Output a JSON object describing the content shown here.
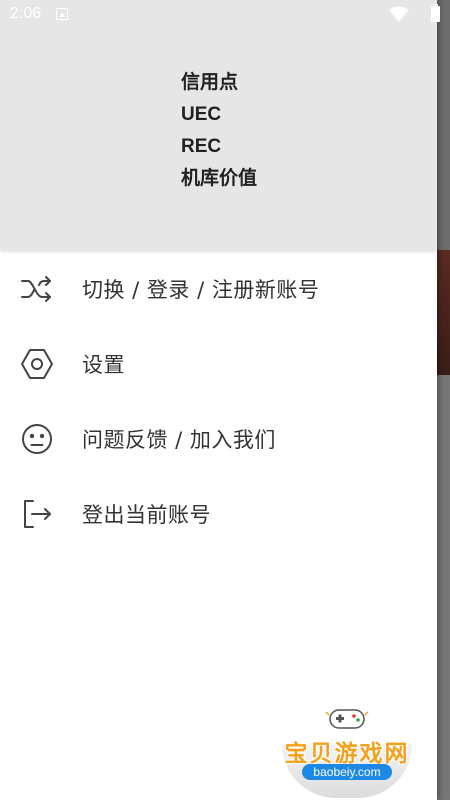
{
  "status_bar": {
    "time": "2:06",
    "icons": [
      "notification-icon",
      "wifi-icon",
      "battery-icon"
    ]
  },
  "drawer": {
    "header": {
      "info_lines": [
        "信用点",
        "UEC",
        "REC",
        "机库价值"
      ]
    },
    "menu": [
      {
        "label": "切换 / 登录 / 注册新账号",
        "icon": "shuffle-icon"
      },
      {
        "label": "设置",
        "icon": "hexagon-settings-icon"
      },
      {
        "label": "问题反馈 / 加入我们",
        "icon": "sad-face-icon"
      },
      {
        "label": "登出当前账号",
        "icon": "logout-icon"
      }
    ]
  },
  "watermark": {
    "title": "宝贝游戏网",
    "url": "baobeiy.com"
  },
  "colors": {
    "header_bg": "#e6e6e6",
    "drawer_bg": "#ffffff",
    "icon_color": "#444444",
    "watermark_orange": "#f2a11c",
    "watermark_blue": "#1e88e5"
  }
}
